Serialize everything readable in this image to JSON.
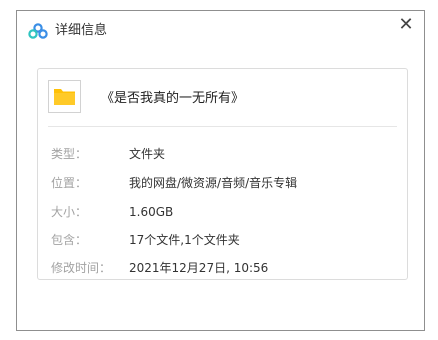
{
  "window": {
    "title": "详细信息",
    "close_glyph": "✕",
    "app_icon": "baidu-netdisk-logo-icon"
  },
  "file": {
    "icon": "folder-icon",
    "name": "《是否我真的一无所有》"
  },
  "details": [
    {
      "label": "类型：",
      "value": "文件夹"
    },
    {
      "label": "位置：",
      "value": "我的网盘/微资源/音频/音乐专辑"
    },
    {
      "label": "大小：",
      "value": "1.60GB"
    },
    {
      "label": "包含：",
      "value": "17个文件,1个文件夹"
    },
    {
      "label": "修改时间：",
      "value": "2021年12月27日, 10:56"
    }
  ],
  "colors": {
    "folder": "#ffc107",
    "logo_blue": "#3a8ee6",
    "logo_teal": "#2fc4c0",
    "label_gray": "#a3a3a3"
  }
}
